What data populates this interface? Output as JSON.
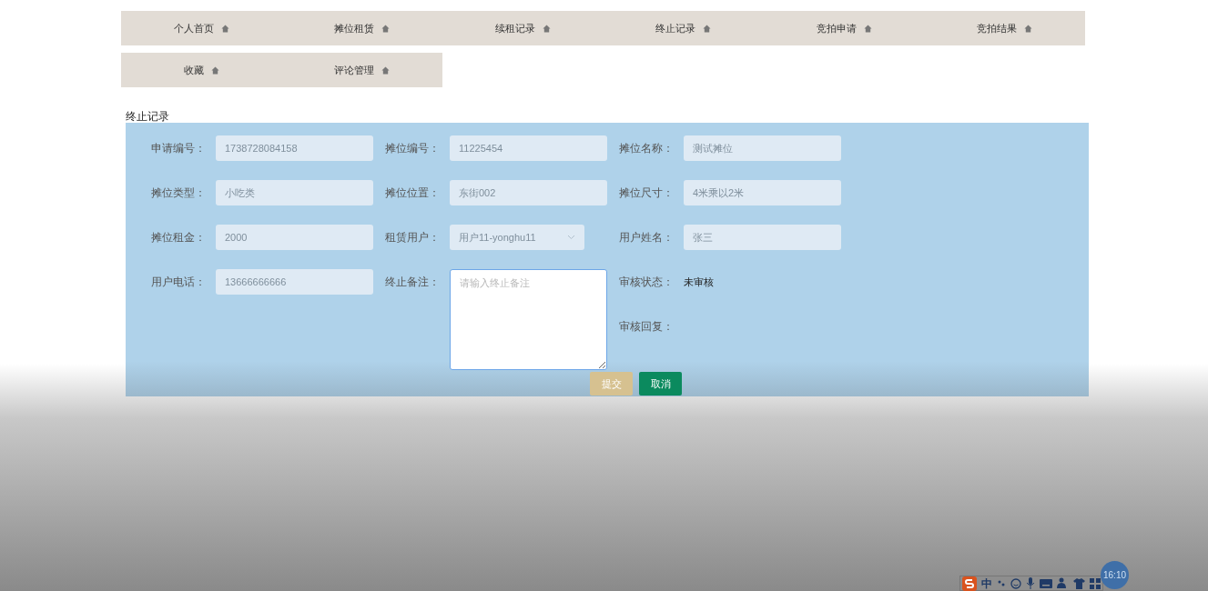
{
  "nav_rows": [
    [
      {
        "label": "个人首页"
      },
      {
        "label": "摊位租赁"
      },
      {
        "label": "续租记录"
      },
      {
        "label": "终止记录"
      },
      {
        "label": "竞拍申请"
      },
      {
        "label": "竞拍结果"
      }
    ],
    [
      {
        "label": "收藏"
      },
      {
        "label": "评论管理"
      }
    ]
  ],
  "section_title": "终止记录",
  "form_columns": [
    [
      {
        "label": "申请编号：",
        "kind": "input",
        "value": "1738728084158"
      },
      {
        "label": "摊位类型：",
        "kind": "input",
        "value": "小吃类"
      },
      {
        "label": "摊位租金：",
        "kind": "input",
        "value": "2000"
      },
      {
        "label": "用户电话：",
        "kind": "input",
        "value": "13666666666"
      }
    ],
    [
      {
        "label": "摊位编号：",
        "kind": "input",
        "value": "11225454"
      },
      {
        "label": "摊位位置：",
        "kind": "input",
        "value": "东街002"
      },
      {
        "label": "租赁用户：",
        "kind": "select",
        "value": "用户11-yonghu11"
      },
      {
        "label": "终止备注：",
        "kind": "textarea",
        "placeholder": "请输入终止备注"
      }
    ],
    [
      {
        "label": "摊位名称：",
        "kind": "input",
        "value": "测试摊位"
      },
      {
        "label": "摊位尺寸：",
        "kind": "input",
        "value": "4米乘以2米"
      },
      {
        "label": "用户姓名：",
        "kind": "input",
        "value": "张三"
      },
      {
        "label": "审核状态：",
        "kind": "text",
        "value": "未审核"
      },
      {
        "label": "审核回复：",
        "kind": "text"
      }
    ]
  ],
  "buttons": [
    {
      "label": "提交",
      "kind": "submit"
    },
    {
      "label": "取消",
      "kind": "cancel"
    }
  ],
  "tray": {
    "ime_label": "中",
    "clock": "16:10"
  }
}
